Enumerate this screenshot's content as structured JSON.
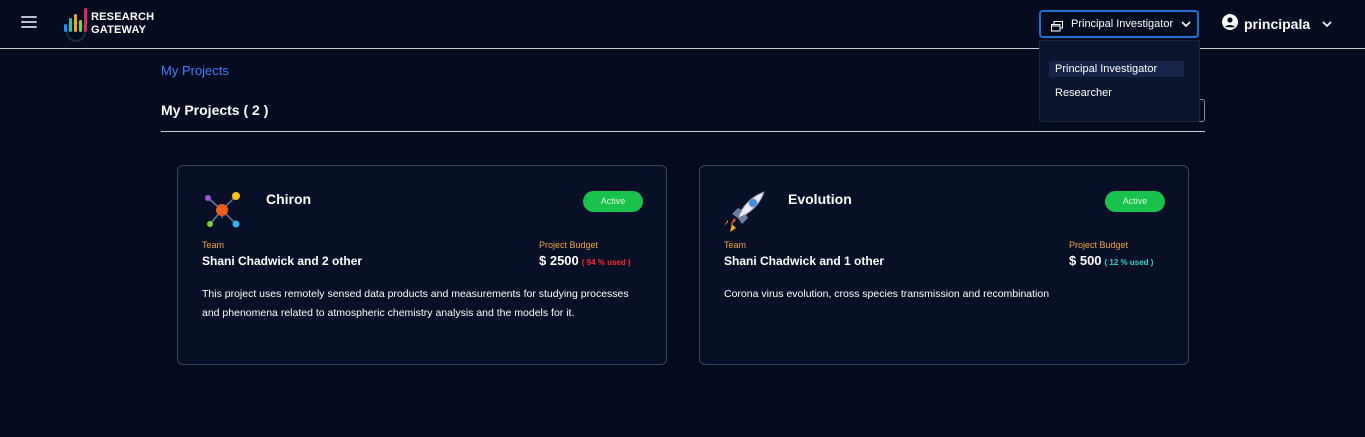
{
  "app": {
    "logo_line1": "RESEARCH",
    "logo_line2": "GATEWAY"
  },
  "header": {
    "role_selected": "Principal Investigator",
    "user_name": "principala"
  },
  "role_dropdown": {
    "options": [
      "Principal Investigator",
      "Researcher"
    ]
  },
  "breadcrumb": "My Projects",
  "section_title": "My Projects ( 2 )",
  "projects": [
    {
      "name": "Chiron",
      "status": "Active",
      "team_label": "Team",
      "team": "Shani Chadwick and 2 other",
      "budget_label": "Project Budget",
      "budget": "$ 2500",
      "used": "( 94 % used )",
      "used_color": "#ff2b2b",
      "description": "This project uses remotely sensed data products and measurements for studying processes and phenomena related to atmospheric chemistry analysis and the models for it.",
      "icon": "molecule-icon"
    },
    {
      "name": "Evolution",
      "status": "Active",
      "team_label": "Team",
      "team": "Shani Chadwick and 1 other",
      "budget_label": "Project Budget",
      "budget": "$ 500",
      "used": "( 12 % used )",
      "used_color": "#34d2c0",
      "description": "Corona virus evolution, cross species transmission and recombination",
      "icon": "rocket-icon"
    }
  ],
  "colors": {
    "background": "#050c1f",
    "accent_blue": "#1f6fd1",
    "link_blue": "#3f7dfc",
    "active_green": "#19c24d",
    "label_orange": "#f2a43a"
  }
}
